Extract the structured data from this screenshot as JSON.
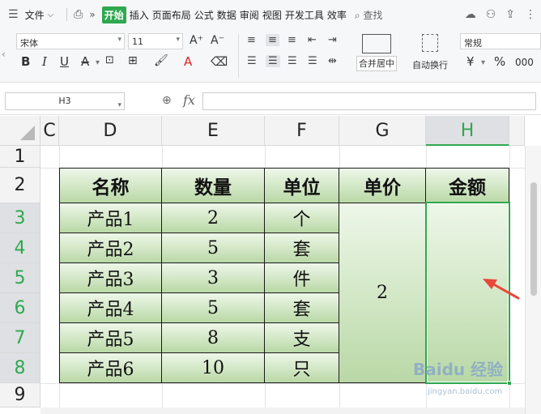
{
  "menubar": {
    "file_label": "文件",
    "tabs": [
      "开始",
      "插入",
      "页面布局",
      "公式",
      "数据",
      "审阅",
      "视图",
      "开发工具",
      "效率"
    ],
    "active_tab": "开始",
    "search_label": "查找"
  },
  "ribbon": {
    "font_name": "宋体",
    "font_size": "11",
    "merge_label": "合并居中",
    "wrap_label": "自动换行",
    "number_format": "常规"
  },
  "formula_bar": {
    "name_box": "H3",
    "fx_label": "fx",
    "formula": ""
  },
  "sheet": {
    "columns": [
      "C",
      "D",
      "E",
      "F",
      "G",
      "H"
    ],
    "rows": [
      "1",
      "2",
      "3",
      "4",
      "5",
      "6",
      "7",
      "8",
      "9"
    ],
    "selected_column": "H",
    "selected_rows": [
      "3",
      "4",
      "5",
      "6",
      "7",
      "8"
    ]
  },
  "table": {
    "headers": [
      "名称",
      "数量",
      "单位",
      "单价",
      "金额"
    ],
    "names": [
      "产品1",
      "产品2",
      "产品3",
      "产品4",
      "产品5",
      "产品6"
    ],
    "quantities": [
      "2",
      "5",
      "3",
      "5",
      "8",
      "10"
    ],
    "units": [
      "个",
      "套",
      "件",
      "套",
      "支",
      "只"
    ],
    "unit_price": "2"
  },
  "watermark": {
    "brand": "Baidu 经验",
    "url": "jingyan.baidu.com"
  },
  "colors": {
    "accent": "#2fa84f",
    "arrow": "#e8473a"
  }
}
